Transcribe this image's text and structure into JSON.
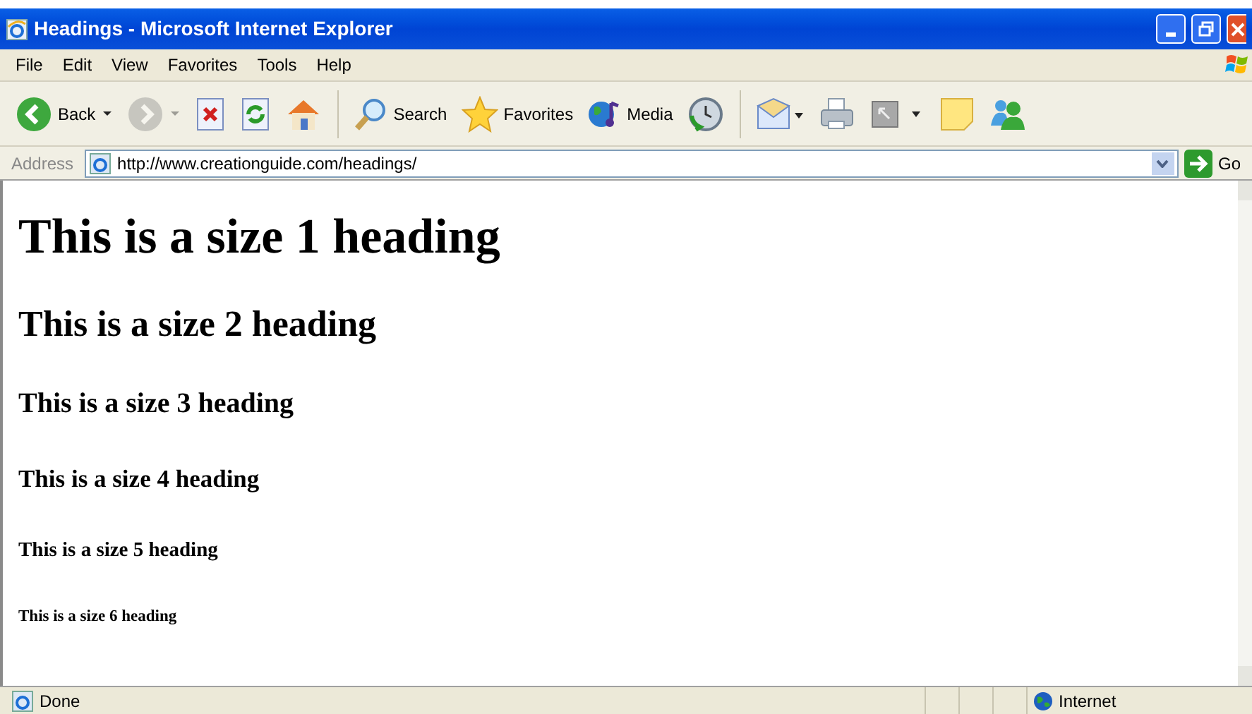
{
  "window": {
    "title": "Headings - Microsoft Internet Explorer"
  },
  "menu": [
    "File",
    "Edit",
    "View",
    "Favorites",
    "Tools",
    "Help"
  ],
  "toolbar": [
    {
      "kind": "back",
      "label": "Back",
      "disabled": false
    },
    {
      "kind": "forward",
      "disabled": true
    },
    {
      "kind": "stop",
      "disabled": false
    },
    {
      "kind": "refresh",
      "disabled": false
    },
    {
      "kind": "home",
      "disabled": false
    },
    {
      "kind": "search",
      "label": "Search",
      "disabled": false
    },
    {
      "kind": "favorites",
      "label": "Favorites",
      "disabled": false
    },
    {
      "kind": "media",
      "label": "Media",
      "disabled": false
    },
    {
      "kind": "history",
      "disabled": false
    },
    {
      "kind": "mail",
      "disabled": false
    },
    {
      "kind": "print",
      "disabled": false
    },
    {
      "kind": "edit",
      "disabled": false
    },
    {
      "kind": "note",
      "disabled": false
    },
    {
      "kind": "messenger",
      "disabled": false
    }
  ],
  "address": {
    "label": "Address",
    "value": "http://www.creationguide.com/headings/",
    "go": "Go"
  },
  "headings": [
    {
      "kind": "h1",
      "text": "This is a size 1 heading"
    },
    {
      "kind": "h2",
      "text": "This is a size 2 heading"
    },
    {
      "kind": "h3",
      "text": "This is a size 3 heading"
    },
    {
      "kind": "h4",
      "text": "This is a size 4 heading"
    },
    {
      "kind": "h5",
      "text": "This is a size 5 heading"
    },
    {
      "kind": "h6",
      "text": "This is a size 6 heading"
    }
  ],
  "status_bar": {
    "text": "Done",
    "zone": "Internet"
  }
}
